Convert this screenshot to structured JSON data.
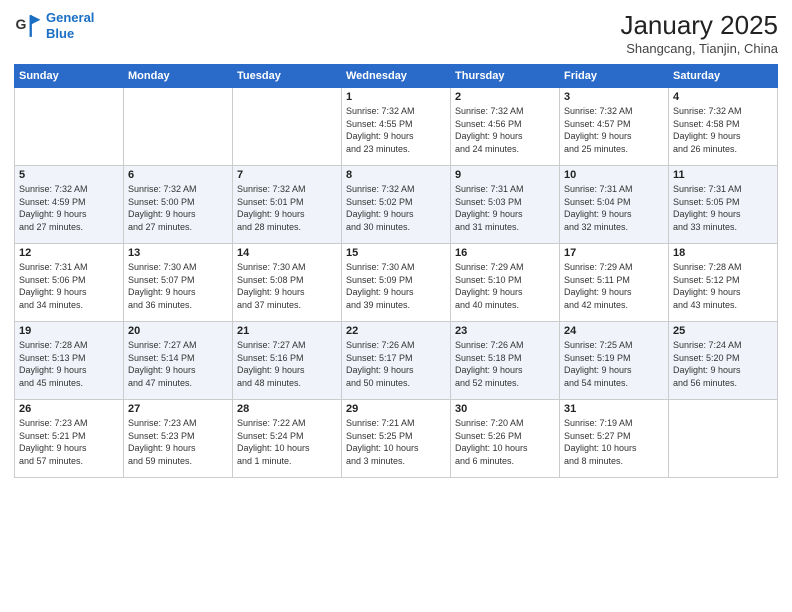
{
  "logo": {
    "line1": "General",
    "line2": "Blue"
  },
  "title": "January 2025",
  "location": "Shangcang, Tianjin, China",
  "days_header": [
    "Sunday",
    "Monday",
    "Tuesday",
    "Wednesday",
    "Thursday",
    "Friday",
    "Saturday"
  ],
  "weeks": [
    [
      {
        "day": "",
        "text": ""
      },
      {
        "day": "",
        "text": ""
      },
      {
        "day": "",
        "text": ""
      },
      {
        "day": "1",
        "text": "Sunrise: 7:32 AM\nSunset: 4:55 PM\nDaylight: 9 hours\nand 23 minutes."
      },
      {
        "day": "2",
        "text": "Sunrise: 7:32 AM\nSunset: 4:56 PM\nDaylight: 9 hours\nand 24 minutes."
      },
      {
        "day": "3",
        "text": "Sunrise: 7:32 AM\nSunset: 4:57 PM\nDaylight: 9 hours\nand 25 minutes."
      },
      {
        "day": "4",
        "text": "Sunrise: 7:32 AM\nSunset: 4:58 PM\nDaylight: 9 hours\nand 26 minutes."
      }
    ],
    [
      {
        "day": "5",
        "text": "Sunrise: 7:32 AM\nSunset: 4:59 PM\nDaylight: 9 hours\nand 27 minutes."
      },
      {
        "day": "6",
        "text": "Sunrise: 7:32 AM\nSunset: 5:00 PM\nDaylight: 9 hours\nand 27 minutes."
      },
      {
        "day": "7",
        "text": "Sunrise: 7:32 AM\nSunset: 5:01 PM\nDaylight: 9 hours\nand 28 minutes."
      },
      {
        "day": "8",
        "text": "Sunrise: 7:32 AM\nSunset: 5:02 PM\nDaylight: 9 hours\nand 30 minutes."
      },
      {
        "day": "9",
        "text": "Sunrise: 7:31 AM\nSunset: 5:03 PM\nDaylight: 9 hours\nand 31 minutes."
      },
      {
        "day": "10",
        "text": "Sunrise: 7:31 AM\nSunset: 5:04 PM\nDaylight: 9 hours\nand 32 minutes."
      },
      {
        "day": "11",
        "text": "Sunrise: 7:31 AM\nSunset: 5:05 PM\nDaylight: 9 hours\nand 33 minutes."
      }
    ],
    [
      {
        "day": "12",
        "text": "Sunrise: 7:31 AM\nSunset: 5:06 PM\nDaylight: 9 hours\nand 34 minutes."
      },
      {
        "day": "13",
        "text": "Sunrise: 7:30 AM\nSunset: 5:07 PM\nDaylight: 9 hours\nand 36 minutes."
      },
      {
        "day": "14",
        "text": "Sunrise: 7:30 AM\nSunset: 5:08 PM\nDaylight: 9 hours\nand 37 minutes."
      },
      {
        "day": "15",
        "text": "Sunrise: 7:30 AM\nSunset: 5:09 PM\nDaylight: 9 hours\nand 39 minutes."
      },
      {
        "day": "16",
        "text": "Sunrise: 7:29 AM\nSunset: 5:10 PM\nDaylight: 9 hours\nand 40 minutes."
      },
      {
        "day": "17",
        "text": "Sunrise: 7:29 AM\nSunset: 5:11 PM\nDaylight: 9 hours\nand 42 minutes."
      },
      {
        "day": "18",
        "text": "Sunrise: 7:28 AM\nSunset: 5:12 PM\nDaylight: 9 hours\nand 43 minutes."
      }
    ],
    [
      {
        "day": "19",
        "text": "Sunrise: 7:28 AM\nSunset: 5:13 PM\nDaylight: 9 hours\nand 45 minutes."
      },
      {
        "day": "20",
        "text": "Sunrise: 7:27 AM\nSunset: 5:14 PM\nDaylight: 9 hours\nand 47 minutes."
      },
      {
        "day": "21",
        "text": "Sunrise: 7:27 AM\nSunset: 5:16 PM\nDaylight: 9 hours\nand 48 minutes."
      },
      {
        "day": "22",
        "text": "Sunrise: 7:26 AM\nSunset: 5:17 PM\nDaylight: 9 hours\nand 50 minutes."
      },
      {
        "day": "23",
        "text": "Sunrise: 7:26 AM\nSunset: 5:18 PM\nDaylight: 9 hours\nand 52 minutes."
      },
      {
        "day": "24",
        "text": "Sunrise: 7:25 AM\nSunset: 5:19 PM\nDaylight: 9 hours\nand 54 minutes."
      },
      {
        "day": "25",
        "text": "Sunrise: 7:24 AM\nSunset: 5:20 PM\nDaylight: 9 hours\nand 56 minutes."
      }
    ],
    [
      {
        "day": "26",
        "text": "Sunrise: 7:23 AM\nSunset: 5:21 PM\nDaylight: 9 hours\nand 57 minutes."
      },
      {
        "day": "27",
        "text": "Sunrise: 7:23 AM\nSunset: 5:23 PM\nDaylight: 9 hours\nand 59 minutes."
      },
      {
        "day": "28",
        "text": "Sunrise: 7:22 AM\nSunset: 5:24 PM\nDaylight: 10 hours\nand 1 minute."
      },
      {
        "day": "29",
        "text": "Sunrise: 7:21 AM\nSunset: 5:25 PM\nDaylight: 10 hours\nand 3 minutes."
      },
      {
        "day": "30",
        "text": "Sunrise: 7:20 AM\nSunset: 5:26 PM\nDaylight: 10 hours\nand 6 minutes."
      },
      {
        "day": "31",
        "text": "Sunrise: 7:19 AM\nSunset: 5:27 PM\nDaylight: 10 hours\nand 8 minutes."
      },
      {
        "day": "",
        "text": ""
      }
    ]
  ]
}
